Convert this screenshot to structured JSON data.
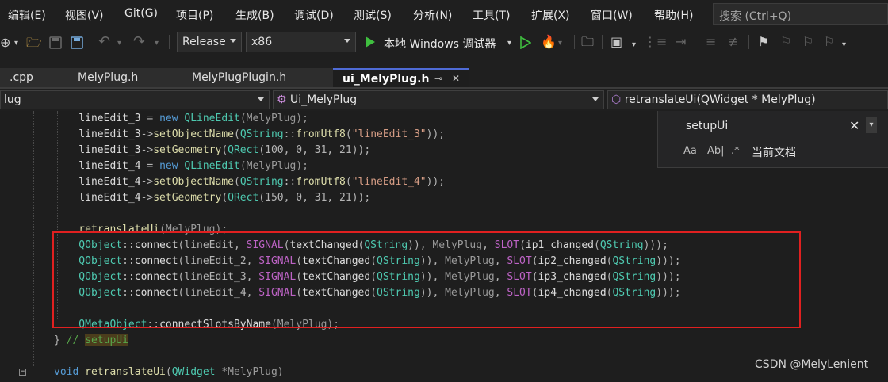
{
  "menu": [
    "编辑(E)",
    "视图(V)",
    "Git(G)",
    "项目(P)",
    "生成(B)",
    "调试(D)",
    "测试(S)",
    "分析(N)",
    "工具(T)",
    "扩展(X)",
    "窗口(W)",
    "帮助(H)"
  ],
  "search": {
    "placeholder": "搜索 (Ctrl+Q)"
  },
  "toolbar": {
    "configuration": "Release",
    "platform": "x86",
    "debugger_label": "本地 Windows 调试器"
  },
  "tabs": [
    {
      "label": ".cpp",
      "active": false
    },
    {
      "label": "MelyPlug.h",
      "active": false
    },
    {
      "label": "MelyPlugPlugin.h",
      "active": false
    },
    {
      "label": "ui_MelyPlug.h",
      "active": true,
      "pin": "⊸",
      "close": "✕"
    }
  ],
  "navigation": {
    "project": "lug",
    "class": "Ui_MelyPlug",
    "member": "retranslateUi(QWidget * MelyPlug)"
  },
  "find_widget": {
    "query": "setupUi",
    "close": "✕",
    "option_case": "Aa",
    "option_word": "Ab|",
    "option_regex": ".*",
    "scope": "当前文档"
  },
  "code": [
    [
      [
        "    lineEdit_3",
        "id"
      ],
      [
        " = ",
        "p"
      ],
      [
        "new",
        "kw"
      ],
      [
        " ",
        "p"
      ],
      [
        "QLineEdit",
        "ty"
      ],
      [
        "(MelyPlug);",
        "par"
      ]
    ],
    [
      [
        "    lineEdit_3",
        "id"
      ],
      [
        "->",
        "p"
      ],
      [
        "setObjectName",
        "fn"
      ],
      [
        "(",
        "p"
      ],
      [
        "QString",
        "ty"
      ],
      [
        "::",
        "p"
      ],
      [
        "fromUtf8",
        "fn"
      ],
      [
        "(",
        "p"
      ],
      [
        "\"lineEdit_3\"",
        "str"
      ],
      [
        "));",
        "p"
      ]
    ],
    [
      [
        "    lineEdit_3",
        "id"
      ],
      [
        "->",
        "p"
      ],
      [
        "setGeometry",
        "fn"
      ],
      [
        "(",
        "p"
      ],
      [
        "QRect",
        "ty"
      ],
      [
        "(100, 0, 31, 21));",
        "p"
      ]
    ],
    [
      [
        "    lineEdit_4",
        "id"
      ],
      [
        " = ",
        "p"
      ],
      [
        "new",
        "kw"
      ],
      [
        " ",
        "p"
      ],
      [
        "QLineEdit",
        "ty"
      ],
      [
        "(MelyPlug);",
        "par"
      ]
    ],
    [
      [
        "    lineEdit_4",
        "id"
      ],
      [
        "->",
        "p"
      ],
      [
        "setObjectName",
        "fn"
      ],
      [
        "(",
        "p"
      ],
      [
        "QString",
        "ty"
      ],
      [
        "::",
        "p"
      ],
      [
        "fromUtf8",
        "fn"
      ],
      [
        "(",
        "p"
      ],
      [
        "\"lineEdit_4\"",
        "str"
      ],
      [
        "));",
        "p"
      ]
    ],
    [
      [
        "    lineEdit_4",
        "id"
      ],
      [
        "->",
        "p"
      ],
      [
        "setGeometry",
        "fn"
      ],
      [
        "(",
        "p"
      ],
      [
        "QRect",
        "ty"
      ],
      [
        "(150, 0, 31, 21));",
        "p"
      ]
    ],
    [],
    [
      [
        "    retranslateUi",
        "fn"
      ],
      [
        "(MelyPlug);",
        "par"
      ]
    ],
    [
      [
        "    QObject",
        "ty"
      ],
      [
        "::",
        "p"
      ],
      [
        "connect",
        "id"
      ],
      [
        "(lineEdit, ",
        "p"
      ],
      [
        "SIGNAL",
        "mac"
      ],
      [
        "(",
        "p"
      ],
      [
        "textChanged",
        "id"
      ],
      [
        "(",
        "p"
      ],
      [
        "QString",
        "ty"
      ],
      [
        ")), ",
        "p"
      ],
      [
        "MelyPlug",
        "par"
      ],
      [
        ", ",
        "p"
      ],
      [
        "SLOT",
        "mac"
      ],
      [
        "(",
        "p"
      ],
      [
        "ip1_changed",
        "id"
      ],
      [
        "(",
        "p"
      ],
      [
        "QString",
        "ty"
      ],
      [
        ")));",
        "p"
      ]
    ],
    [
      [
        "    QObject",
        "ty"
      ],
      [
        "::",
        "p"
      ],
      [
        "connect",
        "id"
      ],
      [
        "(lineEdit_2, ",
        "p"
      ],
      [
        "SIGNAL",
        "mac"
      ],
      [
        "(",
        "p"
      ],
      [
        "textChanged",
        "id"
      ],
      [
        "(",
        "p"
      ],
      [
        "QString",
        "ty"
      ],
      [
        ")), ",
        "p"
      ],
      [
        "MelyPlug",
        "par"
      ],
      [
        ", ",
        "p"
      ],
      [
        "SLOT",
        "mac"
      ],
      [
        "(",
        "p"
      ],
      [
        "ip2_changed",
        "id"
      ],
      [
        "(",
        "p"
      ],
      [
        "QString",
        "ty"
      ],
      [
        ")));",
        "p"
      ]
    ],
    [
      [
        "    QObject",
        "ty"
      ],
      [
        "::",
        "p"
      ],
      [
        "connect",
        "id"
      ],
      [
        "(lineEdit_3, ",
        "p"
      ],
      [
        "SIGNAL",
        "mac"
      ],
      [
        "(",
        "p"
      ],
      [
        "textChanged",
        "id"
      ],
      [
        "(",
        "p"
      ],
      [
        "QString",
        "ty"
      ],
      [
        ")), ",
        "p"
      ],
      [
        "MelyPlug",
        "par"
      ],
      [
        ", ",
        "p"
      ],
      [
        "SLOT",
        "mac"
      ],
      [
        "(",
        "p"
      ],
      [
        "ip3_changed",
        "id"
      ],
      [
        "(",
        "p"
      ],
      [
        "QString",
        "ty"
      ],
      [
        ")));",
        "p"
      ]
    ],
    [
      [
        "    QObject",
        "ty"
      ],
      [
        "::",
        "p"
      ],
      [
        "connect",
        "id"
      ],
      [
        "(lineEdit_4, ",
        "p"
      ],
      [
        "SIGNAL",
        "mac"
      ],
      [
        "(",
        "p"
      ],
      [
        "textChanged",
        "id"
      ],
      [
        "(",
        "p"
      ],
      [
        "QString",
        "ty"
      ],
      [
        ")), ",
        "p"
      ],
      [
        "MelyPlug",
        "par"
      ],
      [
        ", ",
        "p"
      ],
      [
        "SLOT",
        "mac"
      ],
      [
        "(",
        "p"
      ],
      [
        "ip4_changed",
        "id"
      ],
      [
        "(",
        "p"
      ],
      [
        "QString",
        "ty"
      ],
      [
        ")));",
        "p"
      ]
    ],
    [],
    [
      [
        "    QMetaObject",
        "ty"
      ],
      [
        "::",
        "p"
      ],
      [
        "connectSlotsByName",
        "id"
      ],
      [
        "(MelyPlug);",
        "par"
      ]
    ],
    [
      [
        "} ",
        "p"
      ],
      [
        "// ",
        "cm"
      ],
      [
        "setupUi",
        "hl"
      ]
    ],
    [],
    [
      [
        "void",
        "kw"
      ],
      [
        " ",
        "p"
      ],
      [
        "retranslateUi",
        "fn"
      ],
      [
        "(",
        "p"
      ],
      [
        "QWidget",
        "ty"
      ],
      [
        " *MelyPlug)",
        "par"
      ]
    ]
  ],
  "watermark": "CSDN @MelyLenient",
  "colors": {
    "accent_tab": "#4f6bd6",
    "highlight_box": "#e02020",
    "run_green": "#3fbf3f"
  }
}
